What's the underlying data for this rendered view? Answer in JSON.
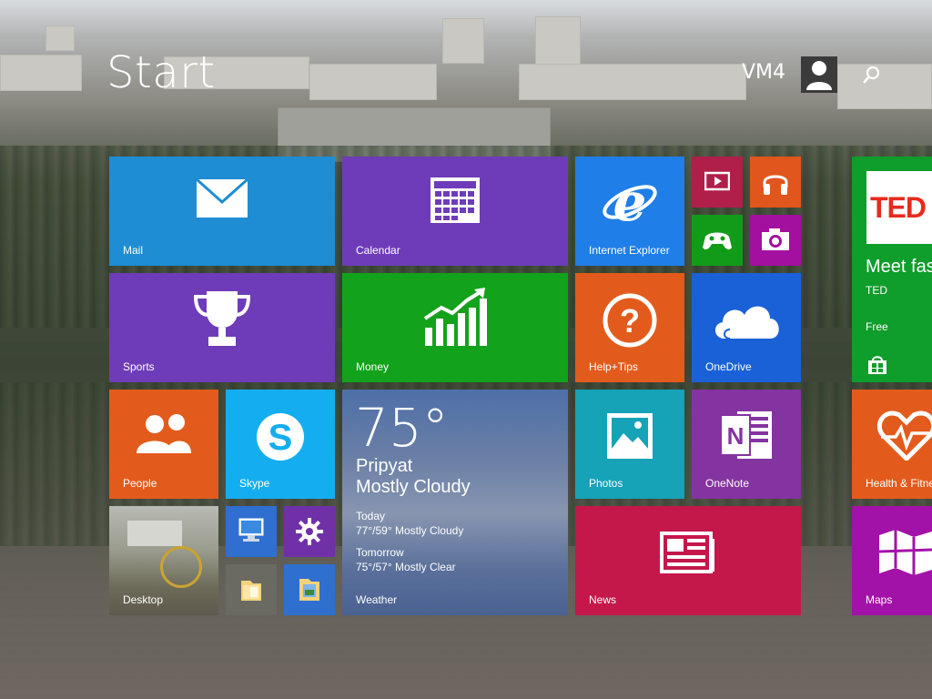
{
  "header": {
    "title": "Start",
    "user_name": "VM4",
    "avatar_icon": "user-silhouette-icon",
    "search_icon": "search-icon"
  },
  "colors": {
    "mail": "#1e8dd4",
    "calendar": "#6e3cb8",
    "ie": "#1f7ee8",
    "video": "#b01e4a",
    "music": "#e0561c",
    "games": "#129b18",
    "camera": "#a30f9e",
    "ted": "#0f9d2b",
    "sports": "#6e3cb8",
    "money": "#13a21b",
    "help": "#e35b1c",
    "onedrive": "#1a61d8",
    "people": "#e35b1c",
    "skype": "#14aef0",
    "weather": "#5674a8",
    "photos": "#16a2b7",
    "onenote": "#8434a0",
    "health": "#e35b1c",
    "desktop": "#8a8a80",
    "computer": "#2e6fcf",
    "settings": "#7030a8",
    "fileexplorer": "#6a6a62",
    "libraries": "#2e6fcf",
    "news": "#c4174a",
    "maps": "#a312a8"
  },
  "tiles": {
    "mail": {
      "label": "Mail",
      "icon": "envelope-icon"
    },
    "calendar": {
      "label": "Calendar",
      "icon": "calendar-grid-icon"
    },
    "ie": {
      "label": "Internet Explorer",
      "icon": "internet-explorer-icon"
    },
    "video": {
      "icon": "video-play-icon"
    },
    "music": {
      "icon": "headphones-icon"
    },
    "games": {
      "icon": "game-controller-icon"
    },
    "camera": {
      "icon": "camera-icon"
    },
    "ted": {
      "logo": "TED",
      "title": "Meet fas",
      "publisher": "TED",
      "price": "Free",
      "icon": "store-icon"
    },
    "sports": {
      "label": "Sports",
      "icon": "trophy-icon"
    },
    "money": {
      "label": "Money",
      "icon": "chart-up-icon"
    },
    "help": {
      "label": "Help+Tips",
      "icon": "question-icon"
    },
    "onedrive": {
      "label": "OneDrive",
      "icon": "cloud-icon"
    },
    "people": {
      "label": "People",
      "icon": "people-icon"
    },
    "skype": {
      "label": "Skype",
      "icon": "skype-icon"
    },
    "weather": {
      "label": "Weather",
      "temp": "75°",
      "city": "Pripyat",
      "condition": "Mostly Cloudy",
      "today_label": "Today",
      "today_forecast": "77°/59° Mostly Cloudy",
      "tomorrow_label": "Tomorrow",
      "tomorrow_forecast": "75°/57° Mostly Clear"
    },
    "photos": {
      "label": "Photos",
      "icon": "photo-icon"
    },
    "onenote": {
      "label": "OneNote",
      "icon": "onenote-icon"
    },
    "health": {
      "label": "Health & Fitne",
      "icon": "heart-pulse-icon"
    },
    "desktop": {
      "label": "Desktop"
    },
    "computer": {
      "icon": "computer-icon"
    },
    "settings": {
      "icon": "gear-icon"
    },
    "fileexplorer": {
      "icon": "folder-icon"
    },
    "libraries": {
      "icon": "libraries-icon"
    },
    "news": {
      "label": "News",
      "icon": "newspaper-icon"
    },
    "maps": {
      "label": "Maps",
      "icon": "map-icon"
    }
  }
}
